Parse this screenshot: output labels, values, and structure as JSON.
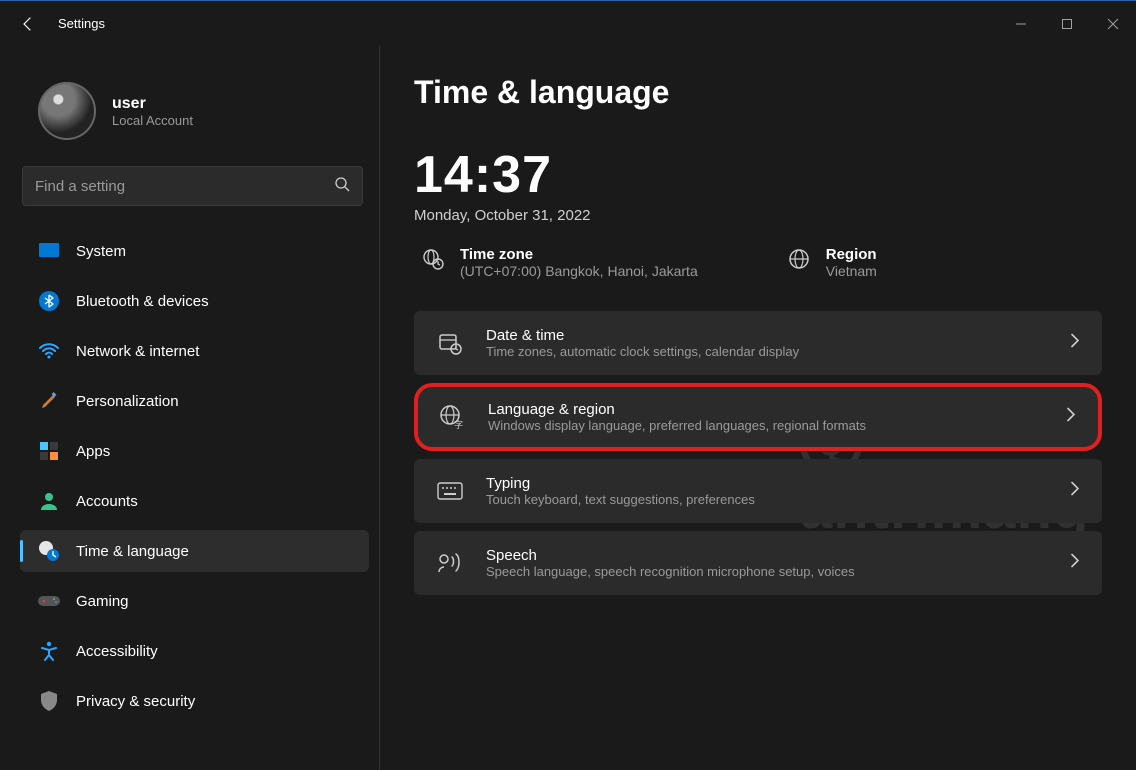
{
  "window": {
    "title": "Settings"
  },
  "profile": {
    "name": "user",
    "subtitle": "Local Account"
  },
  "search": {
    "placeholder": "Find a setting"
  },
  "sidebar": {
    "items": [
      {
        "label": "System"
      },
      {
        "label": "Bluetooth & devices"
      },
      {
        "label": "Network & internet"
      },
      {
        "label": "Personalization"
      },
      {
        "label": "Apps"
      },
      {
        "label": "Accounts"
      },
      {
        "label": "Time & language"
      },
      {
        "label": "Gaming"
      },
      {
        "label": "Accessibility"
      },
      {
        "label": "Privacy & security"
      }
    ]
  },
  "page": {
    "title": "Time & language",
    "clock": "14:37",
    "date": "Monday, October 31, 2022",
    "timezone_label": "Time zone",
    "timezone_value": "(UTC+07:00) Bangkok, Hanoi, Jakarta",
    "region_label": "Region",
    "region_value": "Vietnam"
  },
  "cards": [
    {
      "title": "Date & time",
      "sub": "Time zones, automatic clock settings, calendar display"
    },
    {
      "title": "Language & region",
      "sub": "Windows display language, preferred languages, regional formats"
    },
    {
      "title": "Typing",
      "sub": "Touch keyboard, text suggestions, preferences"
    },
    {
      "title": "Speech",
      "sub": "Speech language, speech recognition microphone setup, voices"
    }
  ],
  "watermark": "antrimang"
}
